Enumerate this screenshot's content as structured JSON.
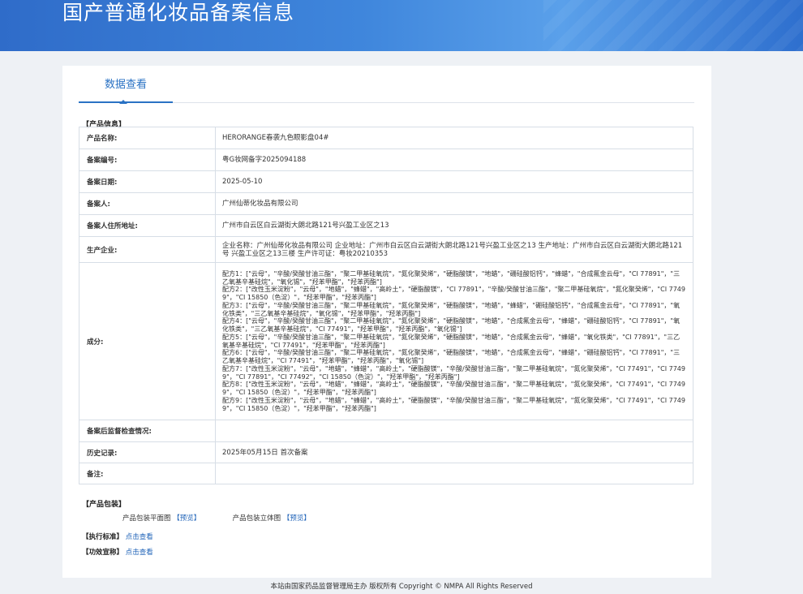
{
  "header": {
    "title": "国产普通化妆品备案信息"
  },
  "tabs": [
    {
      "label": "数据查看"
    }
  ],
  "sections": {
    "product_info": "【产品信息】",
    "packaging": "【产品包装】",
    "standard": "【执行标准】",
    "efficacy": "【功效宣称】"
  },
  "product": {
    "name_label": "产品名称:",
    "name": "HERORANGE春袭九色眼影盘04#",
    "reg_no_label": "备案编号:",
    "reg_no": "粤G妆网备字2025094188",
    "date_label": "备案日期:",
    "date": "2025-05-10",
    "registrant_label": "备案人:",
    "registrant": "广州仙蒂化妆品有限公司",
    "address_label": "备案人住所地址:",
    "address": "广州市白云区白云湖街大朗北路121号兴盈工业区之13",
    "manufacturer_label": "生产企业:",
    "manufacturer": "企业名称：广州仙蒂化妆品有限公司 企业地址：广州市白云区白云湖街大朗北路121号兴盈工业区之13 生产地址：广州市白云区白云湖街大朗北路121号 兴盈工业区之13三楼 生产许可证：粤妆20210353",
    "ingredients_label": "成分:",
    "ingredients": [
      "配方1：[\"云母\"，\"辛酸/癸酸甘油三酯\"，\"聚二甲基硅氧烷\"，\"氮化聚癸烯\"，\"硬脂酸镁\"，\"地蜡\"，\"硼硅酸铝钙\"，\"蜂蜡\"，\"合成氟金云母\"，\"CI 77891\"，\"三乙氧基辛基硅烷\"，\"氧化锡\"，\"羟苯甲酯\"，\"羟苯丙酯\"]",
      "配方2：[\"改性玉米淀粉\"，\"云母\"，\"地蜡\"，\"蜂蜡\"，\"高岭土\"，\"硬脂酸镁\"，\"CI 77891\"，\"辛酸/癸酸甘油三酯\"，\"聚二甲基硅氧烷\"，\"氮化聚癸烯\"，\"CI 77499\"，\"CI 15850（色淀）\"，\"羟苯甲酯\"，\"羟苯丙酯\"]",
      "配方3：[\"云母\"，\"辛酸/癸酸甘油三酯\"，\"聚二甲基硅氧烷\"，\"氮化聚癸烯\"，\"硬脂酸镁\"，\"地蜡\"，\"蜂蜡\"，\"硼硅酸铝钙\"，\"合成氟金云母\"，\"CI 77891\"，\"氧化铁类\"，\"三乙氧基辛基硅烷\"，\"氧化锡\"，\"羟苯甲酯\"，\"羟苯丙酯\"]",
      "配方4：[\"云母\"，\"辛酸/癸酸甘油三酯\"，\"聚二甲基硅氧烷\"，\"氮化聚癸烯\"，\"硬脂酸镁\"，\"地蜡\"，\"合成氟金云母\"，\"蜂蜡\"，\"硼硅酸铝钙\"，\"CI 77891\"，\"氧化铁类\"，\"三乙氧基辛基硅烷\"，\"CI 77491\"，\"羟苯甲酯\"，\"羟苯丙酯\"，\"氧化锡\"]",
      "配方5：[\"云母\"，\"辛酸/癸酸甘油三酯\"，\"聚二甲基硅氧烷\"，\"氮化聚癸烯\"，\"硬脂酸镁\"，\"地蜡\"，\"合成氟金云母\"，\"蜂蜡\"，\"氧化铁类\"，\"CI 77891\"，\"三乙氧基辛基硅烷\"，\"CI 77491\"，\"羟苯甲酯\"，\"羟苯丙酯\"]",
      "配方6：[\"云母\"，\"辛酸/癸酸甘油三酯\"，\"聚二甲基硅氧烷\"，\"氮化聚癸烯\"，\"硬脂酸镁\"，\"地蜡\"，\"合成氟金云母\"，\"蜂蜡\"，\"硼硅酸铝钙\"，\"CI 77891\"，\"三乙氧基辛基硅烷\"，\"CI 77491\"，\"羟苯甲酯\"，\"羟苯丙酯\"，\"氧化锡\"]",
      "配方7：[\"改性玉米淀粉\"，\"云母\"，\"地蜡\"，\"蜂蜡\"，\"高岭土\"，\"硬脂酸镁\"，\"辛酸/癸酸甘油三酯\"，\"聚二甲基硅氧烷\"，\"氮化聚癸烯\"，\"CI 77491\"，\"CI 77499\"，\"CI 77891\"，\"CI 77492\"，\"CI 15850（色淀）\"，\"羟苯甲酯\"，\"羟苯丙酯\"]",
      "配方8：[\"改性玉米淀粉\"，\"云母\"，\"地蜡\"，\"蜂蜡\"，\"高岭土\"，\"硬脂酸镁\"，\"辛酸/癸酸甘油三酯\"，\"聚二甲基硅氧烷\"，\"氮化聚癸烯\"，\"CI 77491\"，\"CI 77499\"，\"CI 15850（色淀）\"，\"羟苯甲酯\"，\"羟苯丙酯\"]",
      "配方9：[\"改性玉米淀粉\"，\"云母\"，\"地蜡\"，\"蜂蜡\"，\"高岭土\"，\"硬脂酸镁\"，\"辛酸/癸酸甘油三酯\"，\"聚二甲基硅氧烷\"，\"氮化聚癸烯\"，\"CI 77491\"，\"CI 77499\"，\"CI 15850（色淀）\"，\"羟苯甲酯\"，\"羟苯丙酯\"]"
    ],
    "inspection_label": "备案后监督检查情况:",
    "inspection": "",
    "history_label": "历史记录:",
    "history": "2025年05月15日 首次备案",
    "remarks_label": "备注:",
    "remarks": ""
  },
  "packaging": {
    "flat_label": "产品包装平面图",
    "flat_link": "【预览】",
    "solid_label": "产品包装立体图",
    "solid_link": "【预览】"
  },
  "standard_link": "点击查看",
  "efficacy_link": "点击查看",
  "footer": "本站由国家药品监督管理局主办 版权所有 Copyright © NMPA All Rights Reserved",
  "colors": {
    "accent": "#2a72c4",
    "banner": "#3f86dc",
    "link": "#1f63b8",
    "border": "#9cbbdc"
  }
}
